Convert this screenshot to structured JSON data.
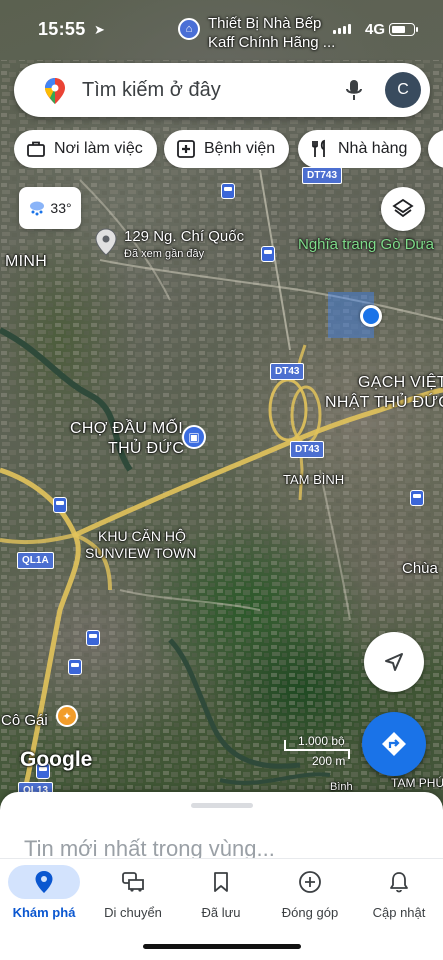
{
  "status_bar": {
    "time": "15:55",
    "network": "4G"
  },
  "search": {
    "placeholder": "Tìm kiếm ở đây",
    "avatar_letter": "C"
  },
  "chips": [
    {
      "label": "Nơi làm việc",
      "icon": "briefcase-icon"
    },
    {
      "label": "Bệnh viện",
      "icon": "hospital-icon"
    },
    {
      "label": "Nhà hàng",
      "icon": "restaurant-icon"
    }
  ],
  "weather": {
    "temperature": "33°",
    "icon": "weather-icon"
  },
  "map": {
    "labels": {
      "kaff_line1": "Thiết Bị Nhà Bếp",
      "kaff_line2": "Kaff Chính Hãng ...",
      "recent_place": "129 Ng. Chí Quốc",
      "recent_sub": "Đã xem gần đây",
      "cemetery": "Nghĩa trang Gò Dưa",
      "minh": "MINH",
      "gach_viet_1": "GẠCH VIỆT",
      "gach_viet_2": "NHẬT THỦ ĐỨC",
      "market_1": "CHỢ ĐẦU MỐI",
      "market_2": "THỦ ĐỨC",
      "tam_binh": "TAM BÌNH",
      "khu_can_ho_1": "KHU CĂN HỘ",
      "khu_can_ho_2": "SUNVIEW TOWN",
      "chua": "Chùa",
      "co_gai": "Cô Gái",
      "tam_phu": "TAM PHÚ",
      "binh_partial": "Bình"
    },
    "road_shields": {
      "dt743": "DT743",
      "dt43_a": "DT43",
      "dt43_b": "DT43",
      "ql1a": "QL1A",
      "ql13": "QL13"
    },
    "scale": {
      "imperial": "1.000 bộ",
      "metric": "200 m"
    },
    "attribution": "Google"
  },
  "sheet": {
    "title": "Tin mới nhất trong vùng..."
  },
  "bottom_nav": [
    {
      "label": "Khám phá",
      "icon": "explore-pin-icon",
      "active": true
    },
    {
      "label": "Di chuyển",
      "icon": "commute-car-icon",
      "active": false
    },
    {
      "label": "Đã lưu",
      "icon": "bookmark-icon",
      "active": false
    },
    {
      "label": "Đóng góp",
      "icon": "add-circle-icon",
      "active": false
    },
    {
      "label": "Cập nhật",
      "icon": "bell-icon",
      "active": false
    }
  ],
  "colors": {
    "accent": "#1a73e8",
    "active_nav_bg": "#d3e3fd",
    "active_nav_text": "#0b57d0"
  }
}
